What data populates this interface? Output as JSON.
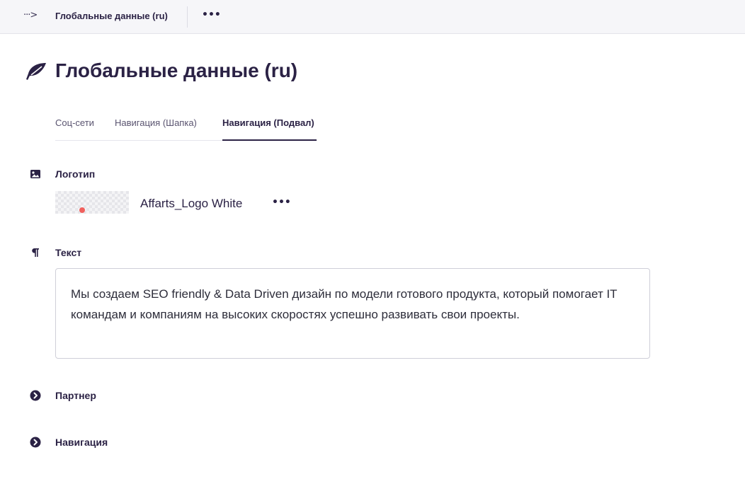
{
  "topbar": {
    "back_glyph": "···>",
    "breadcrumb_title": "Глобальные данные (ru)",
    "more_glyph": "•••"
  },
  "page": {
    "title": "Глобальные данные (ru)",
    "icon": "feather-leaf-icon"
  },
  "tabs": [
    {
      "label": "Соц-сети",
      "active": false
    },
    {
      "label": "Навигация (Шапка)",
      "active": false
    },
    {
      "label": "Навигация (Подвал)",
      "active": true
    }
  ],
  "sections": {
    "logo": {
      "label": "Логотип",
      "icon": "image-icon",
      "file_name": "Affarts_Logo White",
      "more_glyph": "•••"
    },
    "text": {
      "label": "Текст",
      "icon": "paragraph-icon",
      "value": "Мы создаем SEO friendly & Data Driven дизайн по модели готового продукта, который помогает IT командам и компаниям на высоких скоростях успешно развивать свои проекты."
    },
    "partner": {
      "label": "Партнер",
      "icon": "chevron-right-circle-icon"
    },
    "navigation": {
      "label": "Навигация",
      "icon": "chevron-right-circle-icon"
    }
  },
  "colors": {
    "primary": "#2b2245",
    "accent_dot": "#f0605d",
    "topbar_bg": "#f6f6f9"
  }
}
